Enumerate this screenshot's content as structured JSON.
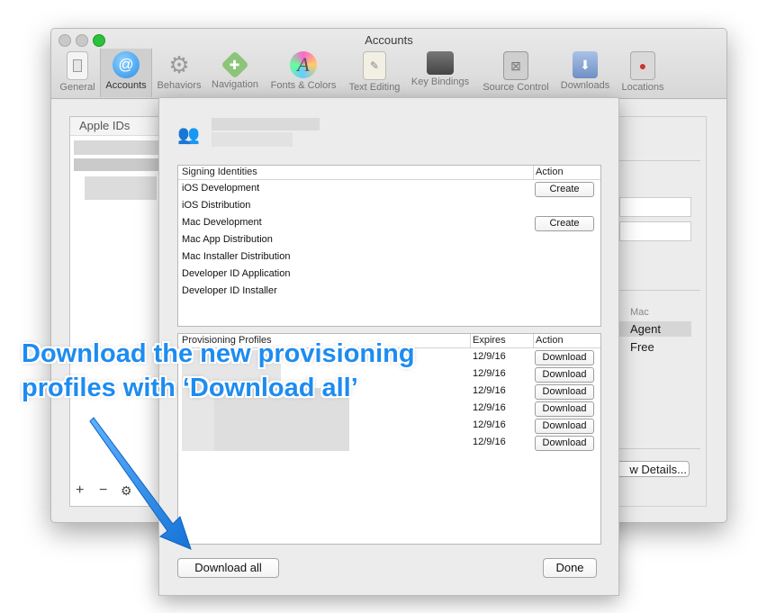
{
  "window": {
    "title": "Accounts"
  },
  "toolbar": {
    "items": [
      {
        "label": "General",
        "icon": "general-icon"
      },
      {
        "label": "Accounts",
        "icon": "at-sign-icon"
      },
      {
        "label": "Behaviors",
        "icon": "gear-icon"
      },
      {
        "label": "Navigation",
        "icon": "navigation-arrows-icon"
      },
      {
        "label": "Fonts & Colors",
        "icon": "font-palette-icon"
      },
      {
        "label": "Text Editing",
        "icon": "text-editing-icon"
      },
      {
        "label": "Key Bindings",
        "icon": "keyboard-key-icon"
      },
      {
        "label": "Source Control",
        "icon": "source-control-icon"
      },
      {
        "label": "Downloads",
        "icon": "download-icon"
      },
      {
        "label": "Locations",
        "icon": "joystick-icon"
      }
    ],
    "selected": "Accounts"
  },
  "sidebar": {
    "header": "Apple IDs",
    "add_symbol": "+",
    "remove_symbol": "−"
  },
  "background_detail": {
    "mac_header": "Mac",
    "agent_label": "Agent",
    "free_label": "Free",
    "view_details_partial": "w Details..."
  },
  "sheet": {
    "signing": {
      "header": "Signing Identities",
      "action_header": "Action",
      "rows": [
        {
          "name": "iOS Development",
          "action": "Create"
        },
        {
          "name": "iOS Distribution",
          "action": ""
        },
        {
          "name": "Mac Development",
          "action": "Create"
        },
        {
          "name": "Mac App Distribution",
          "action": ""
        },
        {
          "name": "Mac Installer Distribution",
          "action": ""
        },
        {
          "name": "Developer ID Application",
          "action": ""
        },
        {
          "name": "Developer ID Installer",
          "action": ""
        }
      ]
    },
    "profiles": {
      "header": "Provisioning Profiles",
      "expires_header": "Expires",
      "action_header": "Action",
      "rows": [
        {
          "expires": "12/9/16",
          "action": "Download"
        },
        {
          "expires": "12/9/16",
          "action": "Download"
        },
        {
          "expires": "12/9/16",
          "action": "Download"
        },
        {
          "expires": "12/9/16",
          "action": "Download"
        },
        {
          "expires": "12/9/16",
          "action": "Download"
        },
        {
          "expires": "12/9/16",
          "action": "Download"
        }
      ]
    },
    "download_all_label": "Download all",
    "done_label": "Done"
  },
  "annotation": {
    "line1": "Download the new provisioning",
    "line2": "profiles with ‘Download all’",
    "color": "#1d8cf0"
  }
}
